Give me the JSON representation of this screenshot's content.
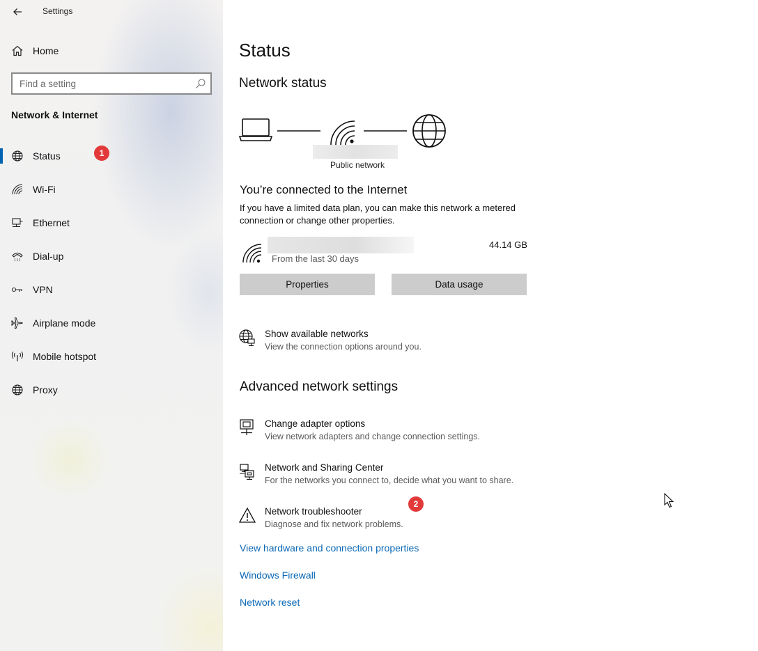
{
  "window": {
    "title": "Settings",
    "back_icon": "back-arrow-icon"
  },
  "sidebar": {
    "home_label": "Home",
    "search_placeholder": "Find a setting",
    "section_title": "Network & Internet",
    "items": [
      {
        "label": "Status",
        "icon": "globe-icon",
        "active": true
      },
      {
        "label": "Wi-Fi",
        "icon": "wifi-icon",
        "active": false
      },
      {
        "label": "Ethernet",
        "icon": "ethernet-icon",
        "active": false
      },
      {
        "label": "Dial-up",
        "icon": "dialup-icon",
        "active": false
      },
      {
        "label": "VPN",
        "icon": "vpn-icon",
        "active": false
      },
      {
        "label": "Airplane mode",
        "icon": "airplane-icon",
        "active": false
      },
      {
        "label": "Mobile hotspot",
        "icon": "hotspot-icon",
        "active": false
      },
      {
        "label": "Proxy",
        "icon": "globe-icon",
        "active": false
      }
    ]
  },
  "annotations": {
    "badge1": "1",
    "badge2": "2",
    "badge_color": "#e23a3a"
  },
  "main": {
    "page_title": "Status",
    "network_status_heading": "Network status",
    "network_type": "Public network",
    "connected_title": "You’re connected to the Internet",
    "connected_desc": "If you have a limited data plan, you can make this network a metered connection or change other properties.",
    "usage_amount": "44.14 GB",
    "usage_period": "From the last 30 days",
    "properties_button": "Properties",
    "data_usage_button": "Data usage",
    "show_networks": {
      "title": "Show available networks",
      "subtitle": "View the connection options around you."
    },
    "advanced_heading": "Advanced network settings",
    "advanced_items": [
      {
        "title": "Change adapter options",
        "subtitle": "View network adapters and change connection settings."
      },
      {
        "title": "Network and Sharing Center",
        "subtitle": "For the networks you connect to, decide what you want to share."
      },
      {
        "title": "Network troubleshooter",
        "subtitle": "Diagnose and fix network problems."
      }
    ],
    "links": {
      "hardware": "View hardware and connection properties",
      "firewall": "Windows Firewall",
      "reset": "Network reset"
    },
    "link_color": "#0b68b5",
    "accent_color": "#0063b1"
  }
}
